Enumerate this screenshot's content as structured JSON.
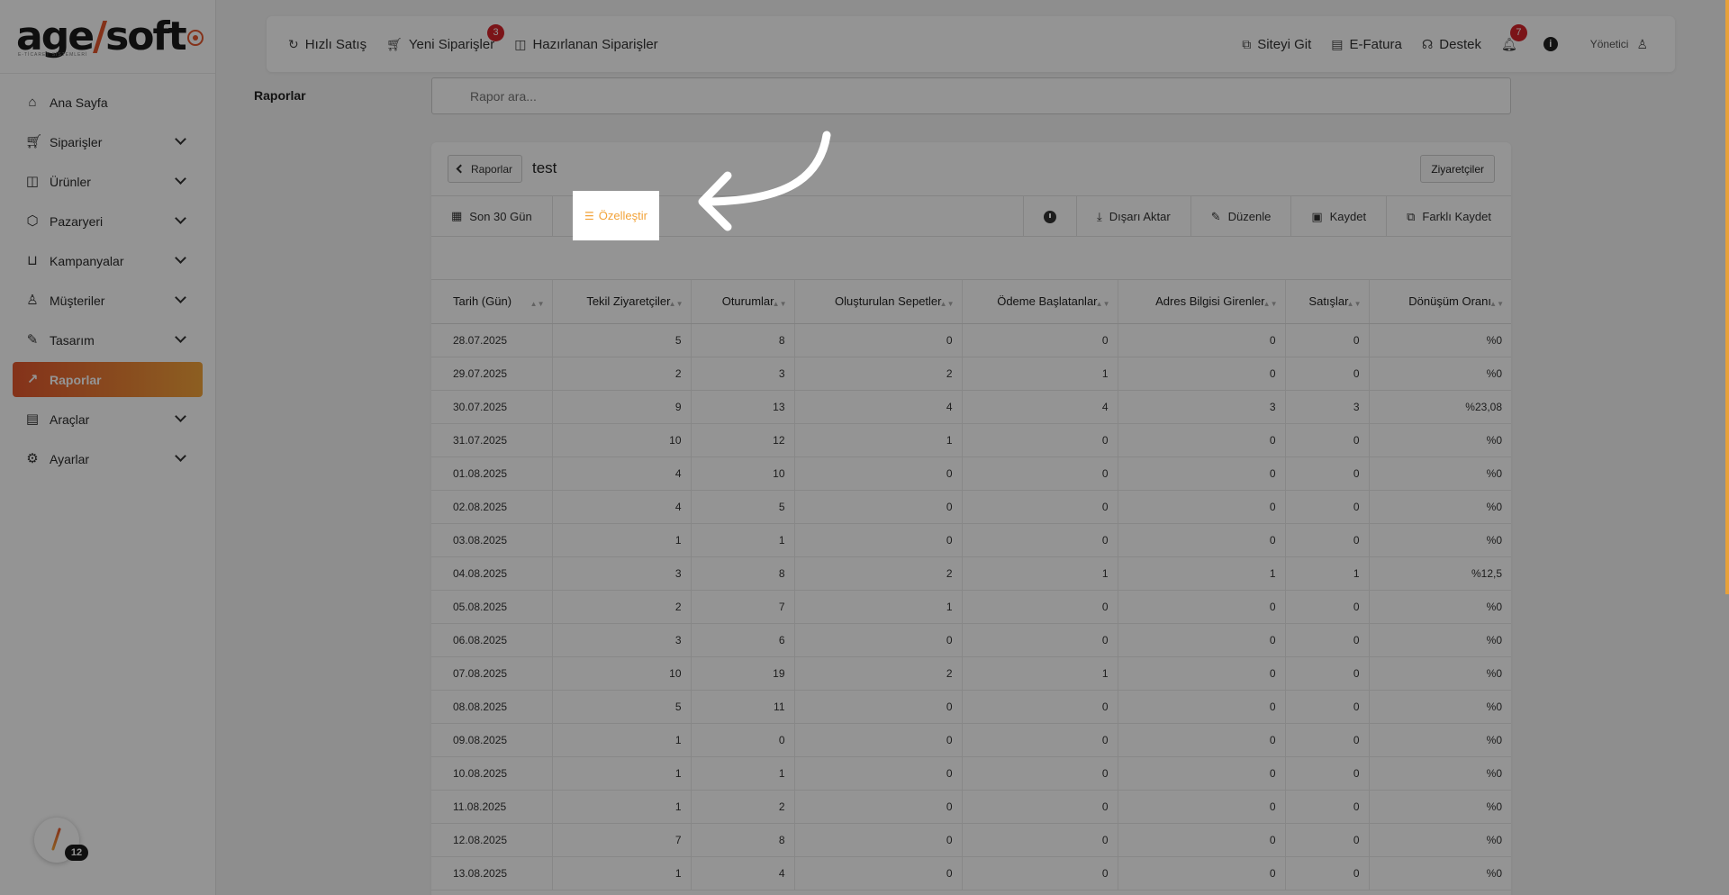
{
  "brand": {
    "name_part1": "age",
    "name_part2": "soft",
    "tagline": "E-TİCARET SİSTEMLERİ"
  },
  "sidebar": {
    "items": [
      {
        "label": "Ana Sayfa",
        "icon": "home-icon",
        "expandable": false
      },
      {
        "label": "Siparişler",
        "icon": "cart-icon",
        "expandable": true
      },
      {
        "label": "Ürünler",
        "icon": "book-icon",
        "expandable": true
      },
      {
        "label": "Pazaryeri",
        "icon": "box-icon",
        "expandable": true
      },
      {
        "label": "Kampanyalar",
        "icon": "basket-icon",
        "expandable": true
      },
      {
        "label": "Müşteriler",
        "icon": "user-icon",
        "expandable": true
      },
      {
        "label": "Tasarım",
        "icon": "brush-icon",
        "expandable": true
      },
      {
        "label": "Raporlar",
        "icon": "chart-icon",
        "expandable": false,
        "active": true
      },
      {
        "label": "Araçlar",
        "icon": "clipboard-icon",
        "expandable": true
      },
      {
        "label": "Ayarlar",
        "icon": "gear-icon",
        "expandable": true
      }
    ],
    "fab_badge": "12"
  },
  "topbar": {
    "quick_sale": "Hızlı Satış",
    "new_orders": "Yeni Siparişler",
    "new_orders_badge": "3",
    "prepared_orders": "Hazırlanan Siparişler",
    "go_site": "Siteyi Git",
    "e_invoice": "E-Fatura",
    "support": "Destek",
    "notifications_badge": "7",
    "user": "Yönetici"
  },
  "page": {
    "title": "Raporlar",
    "search_placeholder": "Rapor ara..."
  },
  "report": {
    "back_label": "Raporlar",
    "name": "test",
    "visitors_button": "Ziyaretçiler",
    "date_range": "Son 30 Gün",
    "customize": "Özelleştir",
    "export": "Dışarı Aktar",
    "edit": "Düzenle",
    "save": "Kaydet",
    "save_as": "Farklı Kaydet"
  },
  "table": {
    "columns": [
      "Tarih (Gün)",
      "Tekil Ziyaretçiler",
      "Oturumlar",
      "Oluşturulan Sepetler",
      "Ödeme Başlatanlar",
      "Adres Bilgisi Girenler",
      "Satışlar",
      "Dönüşüm Oranı"
    ],
    "rows": [
      [
        "28.07.2025",
        "5",
        "8",
        "0",
        "0",
        "0",
        "0",
        "%0"
      ],
      [
        "29.07.2025",
        "2",
        "3",
        "2",
        "1",
        "0",
        "0",
        "%0"
      ],
      [
        "30.07.2025",
        "9",
        "13",
        "4",
        "4",
        "3",
        "3",
        "%23,08"
      ],
      [
        "31.07.2025",
        "10",
        "12",
        "1",
        "0",
        "0",
        "0",
        "%0"
      ],
      [
        "01.08.2025",
        "4",
        "10",
        "0",
        "0",
        "0",
        "0",
        "%0"
      ],
      [
        "02.08.2025",
        "4",
        "5",
        "0",
        "0",
        "0",
        "0",
        "%0"
      ],
      [
        "03.08.2025",
        "1",
        "1",
        "0",
        "0",
        "0",
        "0",
        "%0"
      ],
      [
        "04.08.2025",
        "3",
        "8",
        "2",
        "1",
        "1",
        "1",
        "%12,5"
      ],
      [
        "05.08.2025",
        "2",
        "7",
        "1",
        "0",
        "0",
        "0",
        "%0"
      ],
      [
        "06.08.2025",
        "3",
        "6",
        "0",
        "0",
        "0",
        "0",
        "%0"
      ],
      [
        "07.08.2025",
        "10",
        "19",
        "2",
        "1",
        "0",
        "0",
        "%0"
      ],
      [
        "08.08.2025",
        "5",
        "11",
        "0",
        "0",
        "0",
        "0",
        "%0"
      ],
      [
        "09.08.2025",
        "1",
        "0",
        "0",
        "0",
        "0",
        "0",
        "%0"
      ],
      [
        "10.08.2025",
        "1",
        "1",
        "0",
        "0",
        "0",
        "0",
        "%0"
      ],
      [
        "11.08.2025",
        "1",
        "2",
        "0",
        "0",
        "0",
        "0",
        "%0"
      ],
      [
        "12.08.2025",
        "7",
        "8",
        "0",
        "0",
        "0",
        "0",
        "%0"
      ],
      [
        "13.08.2025",
        "1",
        "4",
        "0",
        "0",
        "0",
        "0",
        "%0"
      ]
    ]
  },
  "colors": {
    "accent_start": "#e4572e",
    "accent_end": "#f2a33a",
    "badge": "#d4232a"
  }
}
